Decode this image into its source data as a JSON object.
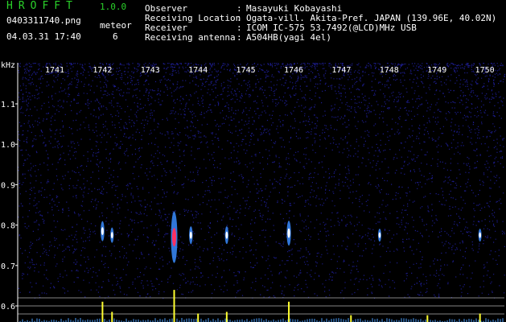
{
  "app": {
    "title": "HROFFT",
    "version": "1.0.0"
  },
  "file": {
    "name": "0403311740.png",
    "date_time": "04.03.31 17:40"
  },
  "meteor": {
    "label": "meteor",
    "count": "6"
  },
  "info": [
    {
      "key": "Observer",
      "value": "Masayuki Kobayashi"
    },
    {
      "key": "Receiving Location",
      "value": "Ogata-vill. Akita-Pref. JAPAN (139.96E, 40.02N)"
    },
    {
      "key": "Receiver",
      "value": "ICOM IC-575 53.7492(@LCD)MHz USB"
    },
    {
      "key": "Receiving antenna",
      "value": "A504HB(yagi 4el)"
    }
  ],
  "info_sep": ":",
  "axis": {
    "y_unit": "kHz",
    "y_ticks": [
      "1.1",
      "1.0",
      "0.9",
      "0.8",
      "0.7",
      "0.6"
    ],
    "x_ticks": [
      "1741",
      "1742",
      "1743",
      "1744",
      "1745",
      "1746",
      "1747",
      "1748",
      "1749",
      "1750"
    ]
  },
  "colors": {
    "background": "#000000",
    "noise": "#1c1c8c",
    "echo_core": "#ff3060",
    "echo_halo": "#3a8cff",
    "spectrum": "#ffff30",
    "spectrum_base": "#4aa0ff",
    "title": "#2ad12a"
  },
  "echoes": [
    {
      "minute": 1742.0,
      "freq": 0.785,
      "strength": 0.35
    },
    {
      "minute": 1742.2,
      "freq": 0.775,
      "strength": 0.25
    },
    {
      "minute": 1743.5,
      "freq": 0.77,
      "strength": 1.0
    },
    {
      "minute": 1743.85,
      "freq": 0.775,
      "strength": 0.3
    },
    {
      "minute": 1744.6,
      "freq": 0.775,
      "strength": 0.3
    },
    {
      "minute": 1745.9,
      "freq": 0.78,
      "strength": 0.45
    },
    {
      "minute": 1747.8,
      "freq": 0.775,
      "strength": 0.2
    },
    {
      "minute": 1749.9,
      "freq": 0.775,
      "strength": 0.2
    }
  ],
  "spectrum_peaks": [
    {
      "minute": 1742.0,
      "level": 0.6
    },
    {
      "minute": 1742.2,
      "level": 0.3
    },
    {
      "minute": 1743.5,
      "level": 0.95
    },
    {
      "minute": 1744.0,
      "level": 0.25
    },
    {
      "minute": 1744.6,
      "level": 0.3
    },
    {
      "minute": 1745.9,
      "level": 0.6
    },
    {
      "minute": 1747.2,
      "level": 0.2
    },
    {
      "minute": 1748.8,
      "level": 0.2
    },
    {
      "minute": 1749.9,
      "level": 0.25
    }
  ]
}
